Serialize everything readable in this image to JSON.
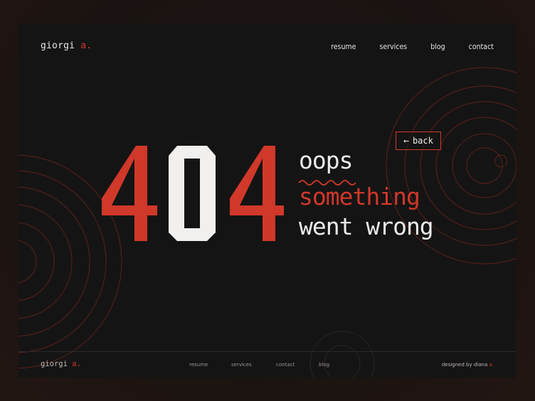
{
  "header": {
    "logo_name": "giorgi",
    "logo_accent": "a.",
    "nav": [
      "resume",
      "services",
      "blog",
      "contact"
    ]
  },
  "error": {
    "code_first": "4",
    "code_middle": "0",
    "code_last": "4",
    "line1": "oops",
    "line2": "something",
    "line3": "went wrong"
  },
  "back_button": {
    "icon": "arrow-left-icon",
    "label": "back"
  },
  "footer": {
    "logo_name": "giorgi",
    "logo_accent": "a.",
    "nav": [
      "resume",
      "services",
      "contact",
      "blog"
    ],
    "credit_prefix": "designed by diana",
    "credit_accent": "a."
  },
  "colors": {
    "accent": "#d0382a",
    "background": "#151414",
    "text": "#ecebea"
  }
}
